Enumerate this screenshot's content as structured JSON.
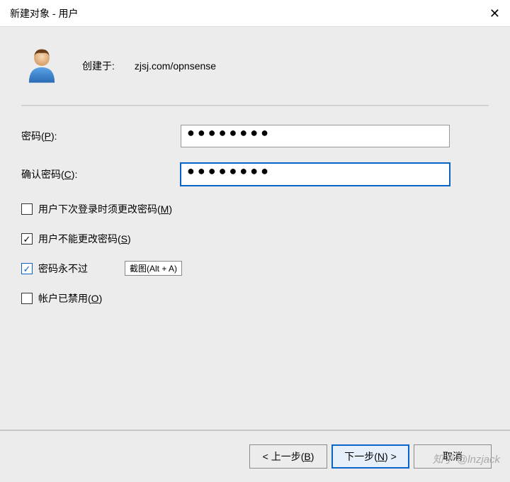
{
  "window": {
    "title": "新建对象 - 用户"
  },
  "header": {
    "created_at_label": "创建于:",
    "path": "zjsj.com/opnsense"
  },
  "form": {
    "password": {
      "label_pre": "密码(",
      "label_hot": "P",
      "label_post": "):",
      "value": "●●●●●●●●"
    },
    "confirm": {
      "label_pre": "确认密码(",
      "label_hot": "C",
      "label_post": "):",
      "value": "●●●●●●●●"
    }
  },
  "checks": {
    "must_change": {
      "pre": "用户下次登录时须更改密码(",
      "hot": "M",
      "post": ")",
      "checked": false
    },
    "cannot_change": {
      "pre": "用户不能更改密码(",
      "hot": "S",
      "post": ")",
      "checked": true
    },
    "never_expire": {
      "pre": "密码永不过",
      "hot": "",
      "post": "",
      "checked": true,
      "tooltip": "截图(Alt + A)"
    },
    "disabled": {
      "pre": "帐户已禁用(",
      "hot": "O",
      "post": ")",
      "checked": false
    }
  },
  "buttons": {
    "back": {
      "prefix": "< 上一步(",
      "hot": "B",
      "suffix": ")"
    },
    "next": {
      "prefix": "下一步(",
      "hot": "N",
      "suffix": ") >"
    },
    "cancel": {
      "label": "取消"
    }
  },
  "watermark": "知乎 @lnzjack"
}
